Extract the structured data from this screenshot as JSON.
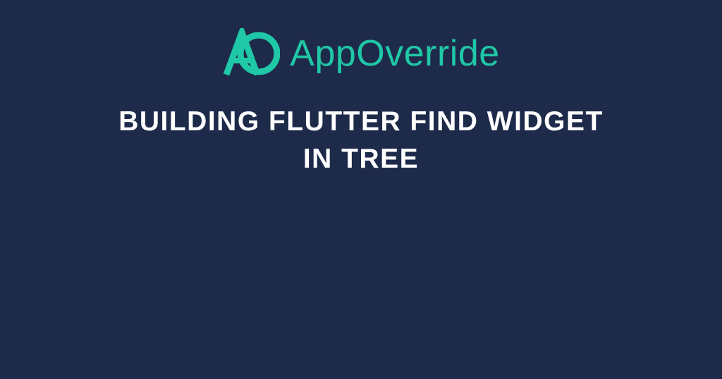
{
  "brand": {
    "name": "AppOverride",
    "accent_color": "#1fc8a6"
  },
  "headline": "BUILDING FLUTTER FIND WIDGET IN TREE",
  "background_color": "#1e2a4a"
}
